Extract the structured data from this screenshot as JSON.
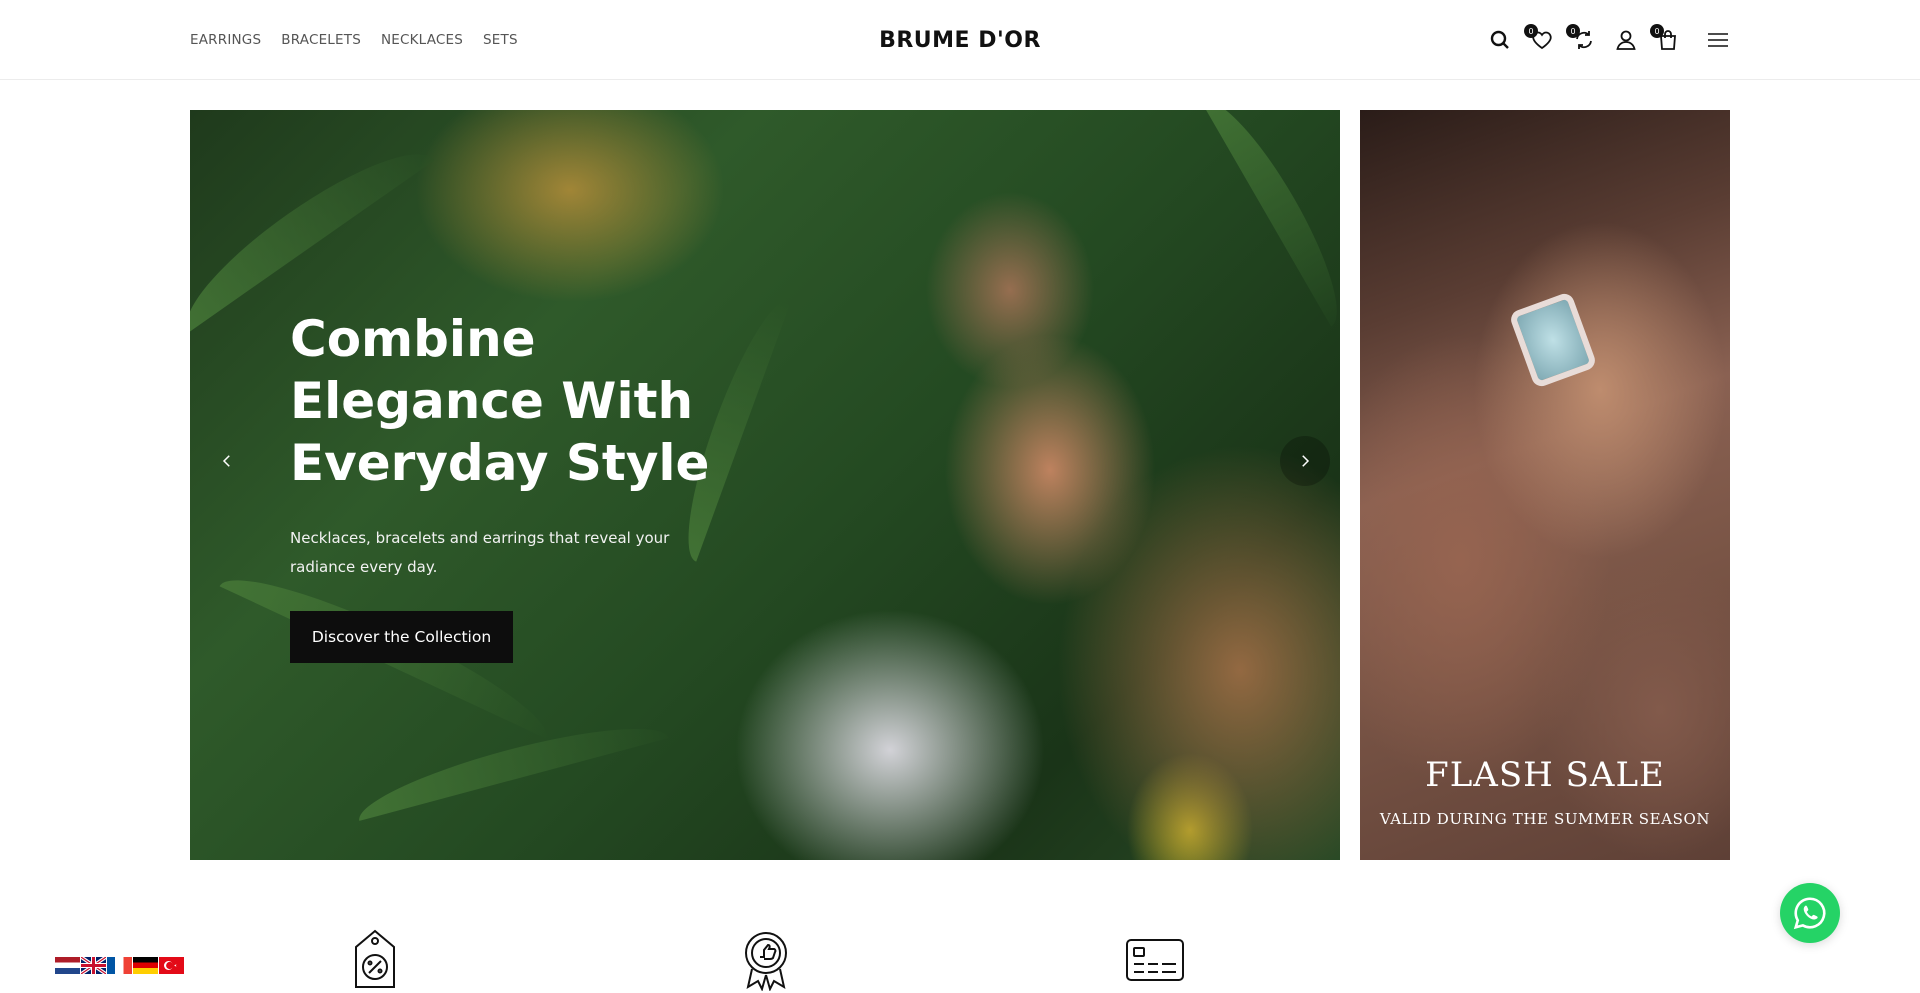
{
  "header": {
    "nav": [
      "EARRINGS",
      "BRACELETS",
      "NECKLACES",
      "SETS"
    ],
    "logo": "BRUME D'OR",
    "icons": [
      {
        "name": "search-icon"
      },
      {
        "name": "wishlist-icon",
        "count": "0"
      },
      {
        "name": "compare-icon",
        "count": "0"
      },
      {
        "name": "account-icon"
      },
      {
        "name": "cart-icon",
        "count": "0"
      },
      {
        "name": "menu-icon"
      }
    ]
  },
  "hero": {
    "title": "Combine Elegance With Everyday Style",
    "subtitle": "Necklaces, bracelets and earrings that reveal your radiance every day.",
    "button": "Discover the Collection"
  },
  "side_banner": {
    "title": "FLASH SALE",
    "subtitle": "VALID DURING THE SUMMER SEASON"
  },
  "languages": [
    "Nederlands",
    "English",
    "Français",
    "Deutsch",
    "Türkçe"
  ],
  "features": [
    {
      "icon": "discount-tag-icon"
    },
    {
      "icon": "quality-badge-icon"
    },
    {
      "icon": "credit-card-icon"
    }
  ],
  "colors": {
    "accent": "#0d0d0d",
    "whatsapp": "#25d366"
  }
}
